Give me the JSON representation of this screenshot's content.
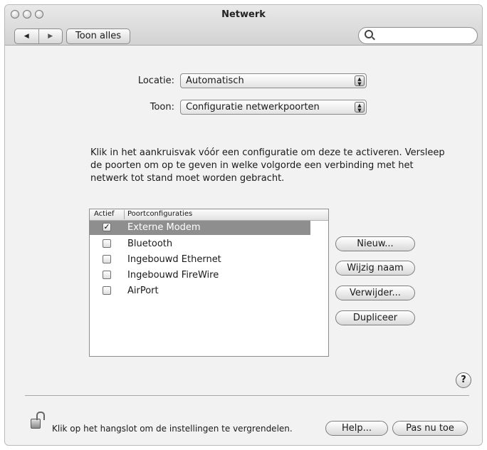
{
  "window": {
    "title": "Netwerk"
  },
  "toolbar": {
    "back_glyph": "◀",
    "forward_glyph": "▶",
    "show_all_label": "Toon alles",
    "search_value": "",
    "search_placeholder": ""
  },
  "location": {
    "label": "Locatie:",
    "value": "Automatisch"
  },
  "show": {
    "label": "Toon:",
    "value": "Configuratie netwerkpoorten"
  },
  "popup_arrow": "▲\n▼",
  "instruction": "Klik in het aankruisvak vóór een configuratie om deze te activeren. Versleep de poorten om op te geven in welke volgorde een verbinding met het netwerk tot stand moet worden gebracht.",
  "ports": {
    "col_active": "Actief",
    "col_config": "Poortconfiguraties",
    "rows": [
      {
        "name": "Externe Modem",
        "checked": true,
        "selected": true
      },
      {
        "name": "Bluetooth",
        "checked": false,
        "selected": false
      },
      {
        "name": "Ingebouwd Ethernet",
        "checked": false,
        "selected": false
      },
      {
        "name": "Ingebouwd FireWire",
        "checked": false,
        "selected": false
      },
      {
        "name": "AirPort",
        "checked": false,
        "selected": false
      }
    ]
  },
  "buttons": {
    "new": "Nieuw...",
    "rename": "Wijzig naam",
    "delete": "Verwijder...",
    "duplicate": "Dupliceer",
    "help": "Help...",
    "apply": "Pas nu toe"
  },
  "help_glyph": "?",
  "checkmark": "✓",
  "lock_text": "Klik op het hangslot om de instellingen te vergrendelen."
}
